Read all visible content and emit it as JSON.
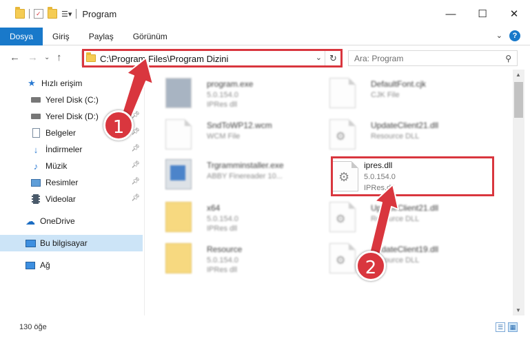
{
  "window": {
    "title": "Program",
    "controls": [
      "—",
      "☐",
      "✕"
    ]
  },
  "ribbon": {
    "tabs": [
      "Dosya",
      "Giriş",
      "Paylaş",
      "Görünüm"
    ],
    "active_tab": "Dosya",
    "help": "?"
  },
  "nav": {
    "address": "C:\\Program Files\\Program Dizini",
    "search_placeholder": "Ara: Program"
  },
  "sidebar": {
    "items": [
      {
        "label": "Hızlı erişim",
        "icon": "star-icon",
        "pinned": false
      },
      {
        "label": "Yerel Disk (C:)",
        "icon": "drive-icon",
        "pinned": true
      },
      {
        "label": "Yerel Disk (D:)",
        "icon": "drive-icon",
        "pinned": true
      },
      {
        "label": "Belgeler",
        "icon": "documents-icon",
        "pinned": true
      },
      {
        "label": "İndirmeler",
        "icon": "download-icon",
        "pinned": true
      },
      {
        "label": "Müzik",
        "icon": "music-icon",
        "pinned": true
      },
      {
        "label": "Resimler",
        "icon": "pictures-icon",
        "pinned": true
      },
      {
        "label": "Videolar",
        "icon": "video-icon",
        "pinned": true
      },
      {
        "label": "OneDrive",
        "icon": "cloud-icon",
        "pinned": false
      },
      {
        "label": "Bu bilgisayar",
        "icon": "computer-icon",
        "pinned": false,
        "selected": true
      },
      {
        "label": "Ağ",
        "icon": "network-icon",
        "pinned": false
      }
    ]
  },
  "files": [
    {
      "name": "program.exe",
      "line2": "5.0.154.0",
      "line3": "IPRes dll",
      "icon": "exe-icon",
      "blurred": true
    },
    {
      "name": "DefaultFont.cjk",
      "line2": "CJK File",
      "line3": "",
      "icon": "document-icon",
      "blurred": true
    },
    {
      "name": "SndToWP12.wcm",
      "line2": "WCM File",
      "line3": "",
      "icon": "document-icon",
      "blurred": true
    },
    {
      "name": "UpdateClient21.dll",
      "line2": "Resource DLL",
      "line3": "",
      "icon": "dll-icon",
      "blurred": true
    },
    {
      "name": "Trgramminstaller.exe",
      "line2": "ABBY Finereader 10...",
      "line3": "",
      "icon": "installer-icon",
      "blurred": true
    },
    {
      "name": "ipres.dll",
      "line2": "5.0.154.0",
      "line3": "IPRes.dll",
      "icon": "dll-icon",
      "blurred": false
    },
    {
      "name": "x64",
      "line2": "5.0.154.0",
      "line3": "IPRes dll",
      "icon": "folder-icon",
      "blurred": true
    },
    {
      "name": "UpdateClient21.dll",
      "line2": "Resource DLL",
      "line3": "",
      "icon": "dll-icon",
      "blurred": true
    },
    {
      "name": "Resource",
      "line2": "5.0.154.0",
      "line3": "IPRes dll",
      "icon": "folder-icon",
      "blurred": true
    },
    {
      "name": "UpdateClient19.dll",
      "line2": "Resource DLL",
      "line3": "",
      "icon": "dll-icon",
      "blurred": true
    }
  ],
  "status": {
    "count": "130 öğe"
  },
  "annotations": {
    "step1": "1",
    "step2": "2",
    "color": "#d9363e"
  }
}
